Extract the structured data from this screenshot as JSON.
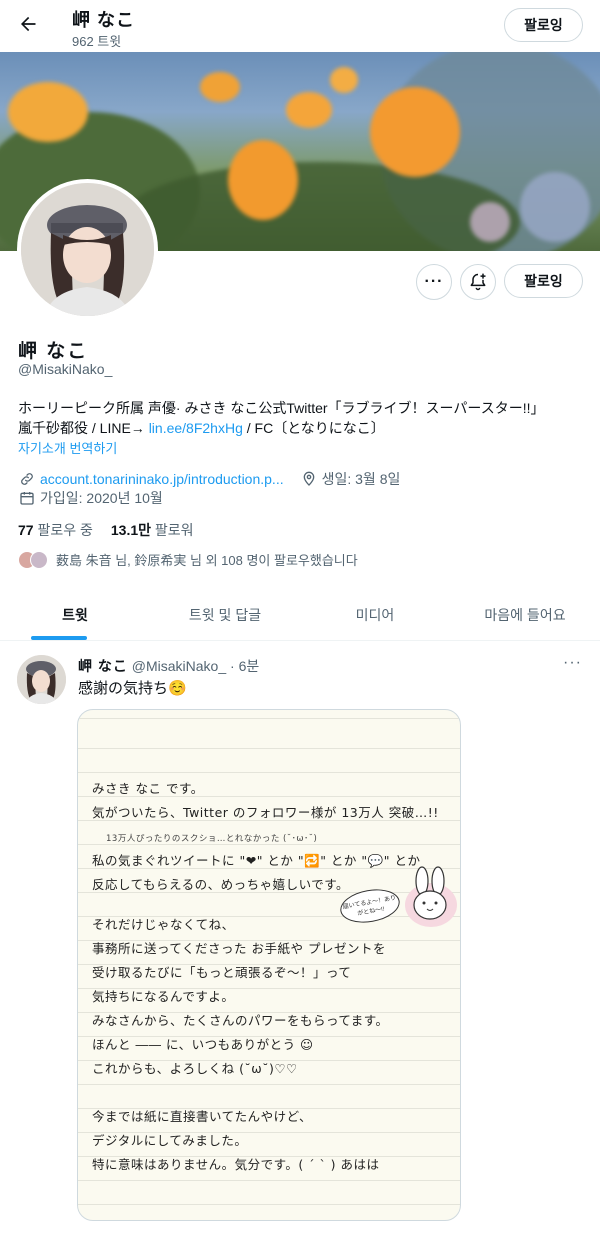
{
  "header": {
    "name": "岬 なこ",
    "tweet_count": "962 트윗",
    "follow_label": "팔로잉"
  },
  "profile": {
    "name": "岬 なこ",
    "handle": "@MisakiNako_",
    "follow_label": "팔로잉",
    "bio_line1": "ホーリーピーク所属 声優· みさき なこ公式Twitter「ラブライブ！スーパースター!!」",
    "bio_line2_prefix": "嵐千砂都役  /  LINE→ ",
    "bio_link": "lin.ee/8F2hxHg",
    "bio_line2_suffix": "  /  FC〔となりになこ〕",
    "translate": "자기소개 번역하기",
    "url": "account.tonarininako.jp/introduction.p...",
    "birthday": "생일: 3월 8일",
    "joined": "가입일: 2020년 10월",
    "following_count": "77",
    "following_label": "팔로우 중",
    "followers_count": "13.1만",
    "followers_label": "팔로워",
    "followed_by": "薮島 朱音 님, 鈴原希実 님 외 108 명이 팔로우했습니다"
  },
  "tabs": [
    "트윗",
    "트윗 및 답글",
    "미디어",
    "마음에 들어요"
  ],
  "tweet": {
    "name": "岬 なこ",
    "handle": "@MisakiNako_",
    "time": "· 6분",
    "text": "感謝の気持ち☺️",
    "note_lines": [
      "みさき なこ  です。",
      "気がついたら、Twitter のフォロワー様が 13万人 突破…!!",
      "13万人ぴったりのスクショ…とれなかった (˘･ω･˘)",
      "私の気まぐれツイートに \"❤\" とか \"🔁\" とか \"💬\" とか",
      "反応してもらえるの、めっちゃ嬉しいです。",
      "それだけじゃなくてね、",
      "事務所に送ってくださった お手紙や プレゼントを",
      "受け取るたびに「もっと頑張るぞ〜！」って",
      "気持ちになるんですよ。",
      "みなさんから、たくさんのパワーをもらってます。",
      "ほんと ―― に、いつもありがとう ☺",
      "これからも、よろしくね (˘ω˘)♡♡",
      "今までは紙に直接書いてたんやけど、",
      "デジタルにしてみました。",
      "特に意味はありません。気分です。( ´ ` ) あはは"
    ],
    "bubble_text": "届いてるよ〜！ありがとね〜!!"
  }
}
